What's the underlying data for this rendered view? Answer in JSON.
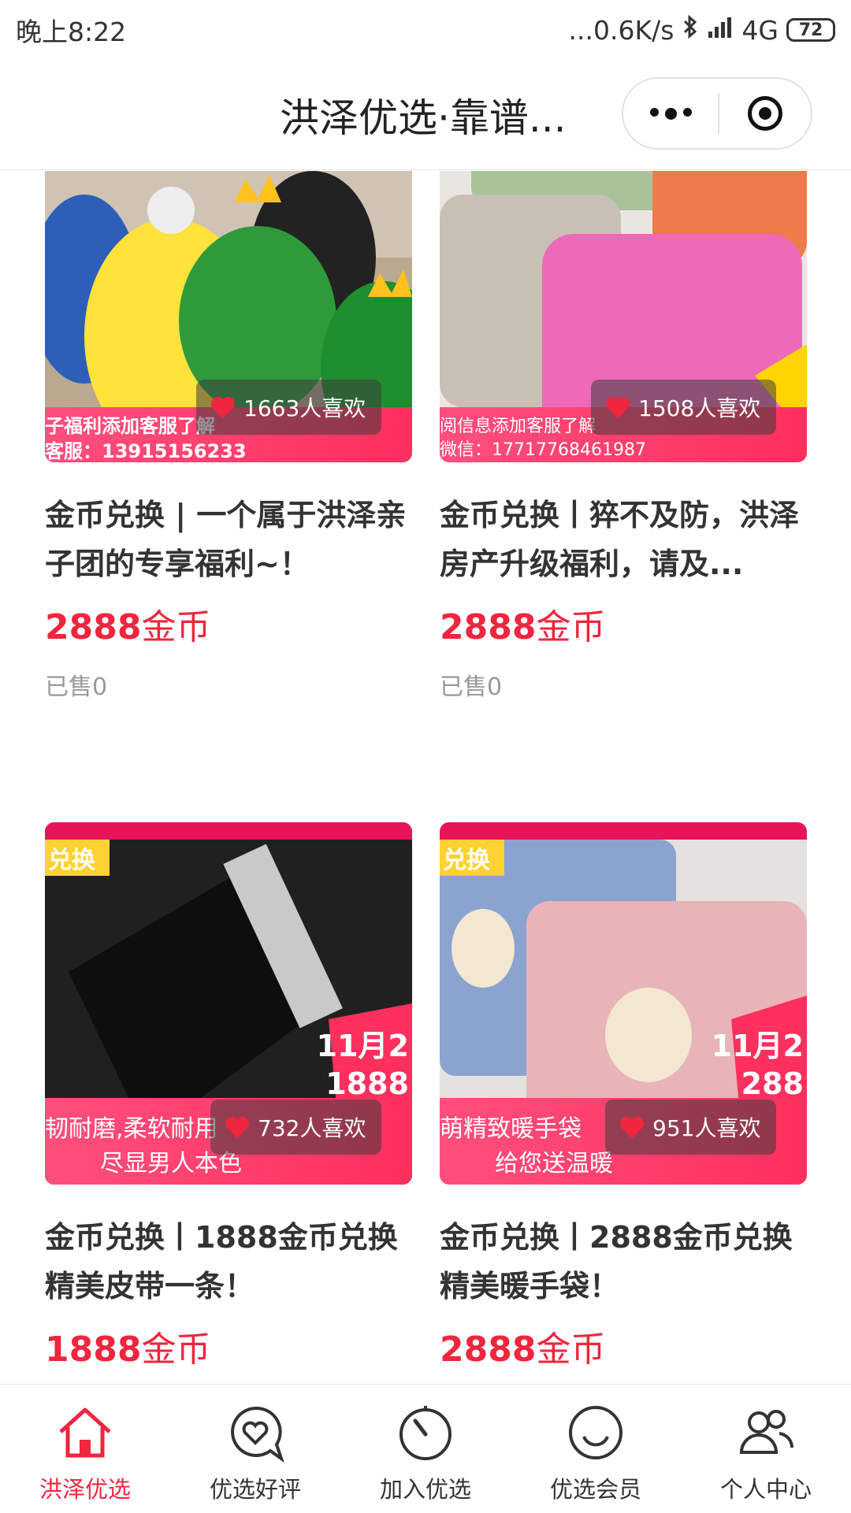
{
  "status_bar": {
    "time": "晚上8:22",
    "network_speed": "...0.6K/s",
    "network": "4G",
    "battery": "72"
  },
  "header": {
    "title": "洪泽优选·靠谱..."
  },
  "products": [
    {
      "likes": "1663人喜欢",
      "title": "金币兑换 | 一个属于洪泽亲子团的专享福利~！",
      "price_number": "2888",
      "price_unit": "金币",
      "sold": "已售0",
      "promo_line1": "子福利添加客服了解",
      "promo_line2": "客服：13915156233"
    },
    {
      "likes": "1508人喜欢",
      "title": "金币兑换丨猝不及防，洪泽房产升级福利，请及...",
      "price_number": "2888",
      "price_unit": "金币",
      "sold": "已售0",
      "promo_line1": "阅信息添加客服了解",
      "promo_line2": "微信：17717768461987"
    },
    {
      "likes": "732人喜欢",
      "title": "金币兑换丨1888金币兑换精美皮带一条！",
      "price_number": "1888",
      "price_unit": "金币",
      "tag": "兑换",
      "promo_line1": "韧耐磨,柔软耐用",
      "promo_line2": "尽显男人本色",
      "badge_line1": "11月2",
      "badge_line2": "1888"
    },
    {
      "likes": "951人喜欢",
      "title": "金币兑换丨2888金币兑换精美暖手袋！",
      "price_number": "2888",
      "price_unit": "金币",
      "tag": "兑换",
      "promo_line1": "萌精致暖手袋",
      "promo_line2": "给您送温暖",
      "badge_line1": "11月2",
      "badge_line2": "288"
    }
  ],
  "tab_bar": [
    {
      "label": "洪泽优选",
      "icon": "home-icon",
      "active": true
    },
    {
      "label": "优选好评",
      "icon": "heart-chat-icon"
    },
    {
      "label": "加入优选",
      "icon": "timer-icon"
    },
    {
      "label": "优选会员",
      "icon": "smile-icon"
    },
    {
      "label": "个人中心",
      "icon": "users-icon"
    }
  ],
  "colors": {
    "accent": "#f0253e",
    "promo_pink": "#ff3a68"
  }
}
